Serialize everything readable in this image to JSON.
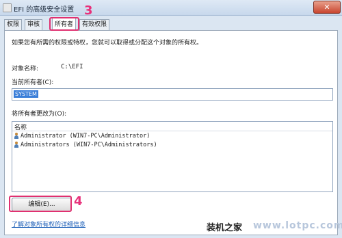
{
  "window": {
    "title": "EFI 的高级安全设置",
    "close_glyph": "✕"
  },
  "tabs": [
    {
      "label": "权限"
    },
    {
      "label": "审核"
    },
    {
      "label": "所有者",
      "active": true
    },
    {
      "label": "有效权限"
    }
  ],
  "markers": {
    "tab_step": "3",
    "button_step": "4"
  },
  "description": "如果您有所需的权限或特权，您就可以取得或分配这个对象的所有权。",
  "object": {
    "label": "对象名称:",
    "value": "C:\\EFI"
  },
  "current_owner": {
    "label": "当前所有者(C):",
    "value": "SYSTEM"
  },
  "change_owner": {
    "label": "将所有者更改为(O):",
    "column_header": "名称",
    "rows": [
      {
        "name": "Administrator (WIN7-PC\\Administrator)",
        "icon": "user-icon"
      },
      {
        "name": "Administrators (WIN7-PC\\Administrators)",
        "icon": "group-icon"
      }
    ]
  },
  "buttons": {
    "edit": "编辑(E)..."
  },
  "link": "了解对象所有权的详细信息",
  "watermark": {
    "left": "装机之家",
    "right": "www.lotpc.com"
  }
}
